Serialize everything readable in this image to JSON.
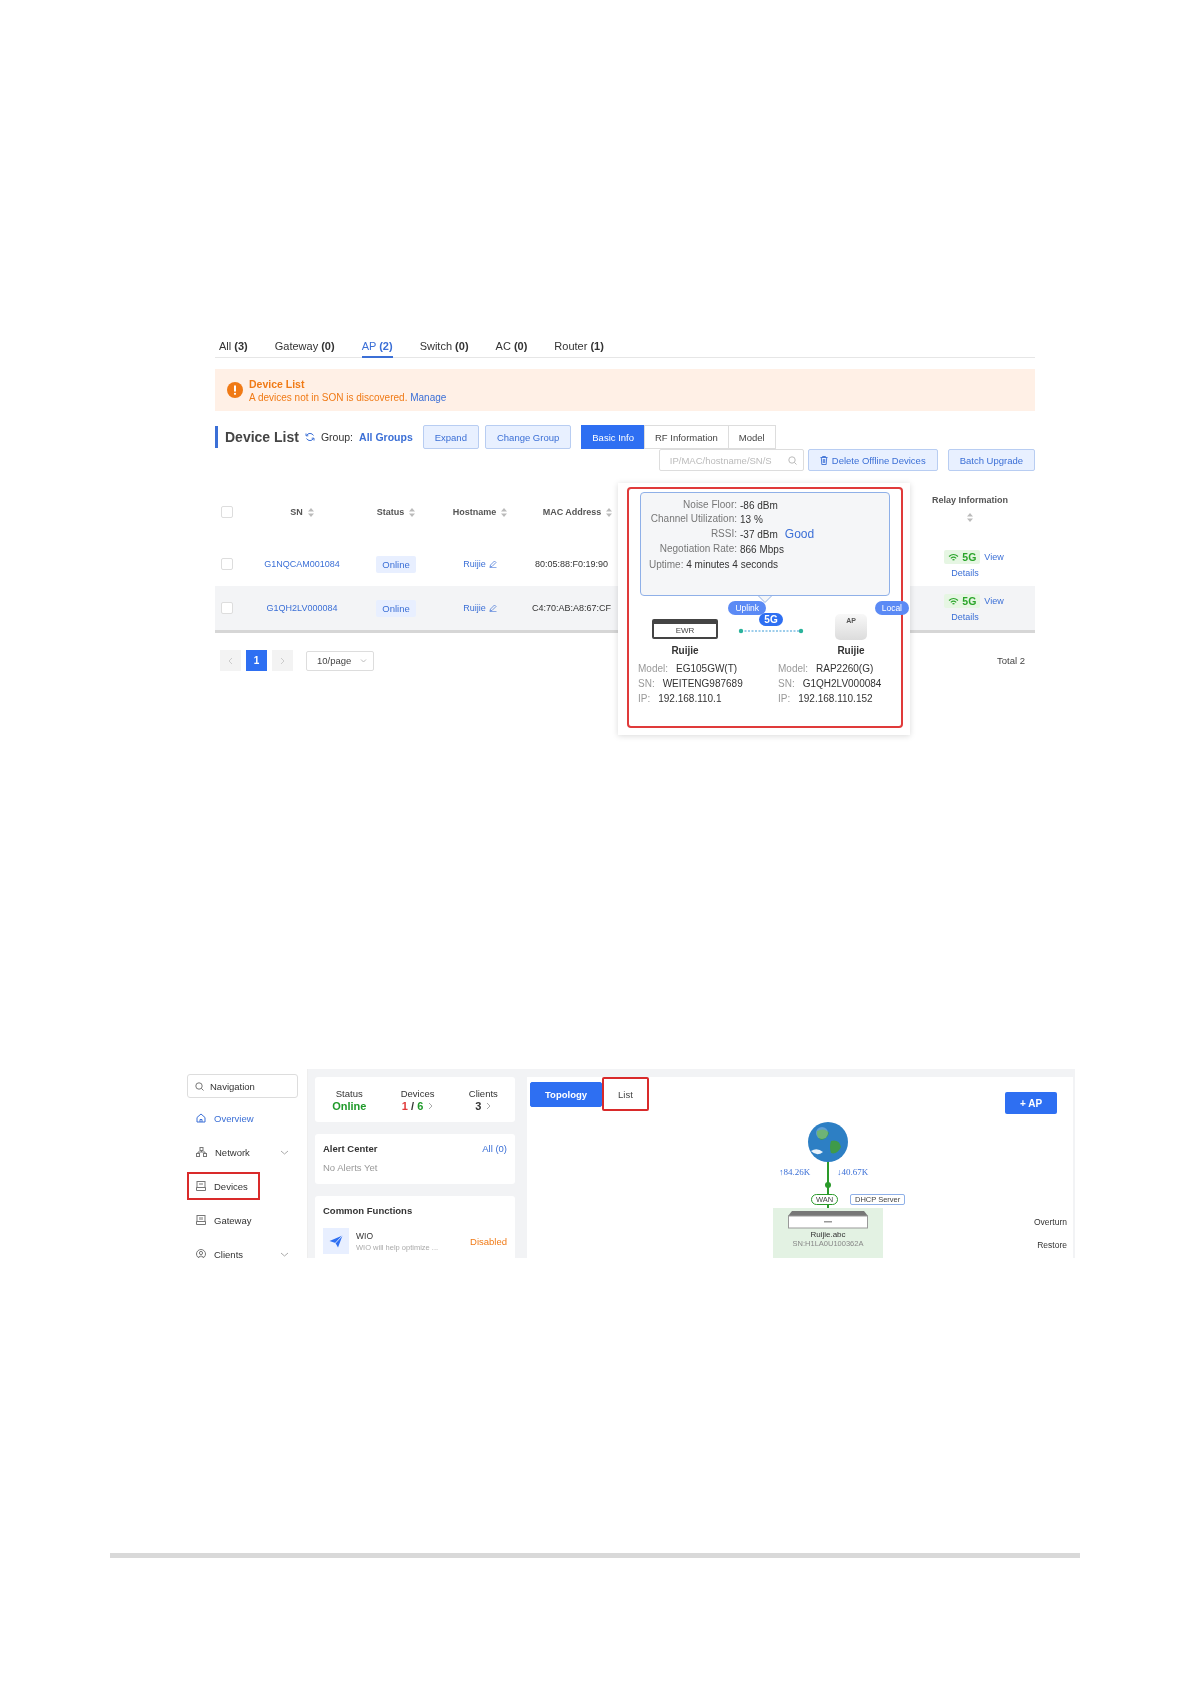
{
  "device_list_screen": {
    "tabs": [
      {
        "label": "All",
        "count": "(3)",
        "selected": false
      },
      {
        "label": "Gateway",
        "count": "(0)",
        "selected": false
      },
      {
        "label": "AP",
        "count": "(2)",
        "selected": true
      },
      {
        "label": "Switch",
        "count": "(0)",
        "selected": false
      },
      {
        "label": "AC",
        "count": "(0)",
        "selected": false
      },
      {
        "label": "Router",
        "count": "(1)",
        "selected": false
      }
    ],
    "alert": {
      "title": "Device List",
      "message": "A devices not in SON is discovered.",
      "link": "Manage"
    },
    "header": {
      "title": "Device List",
      "group_label": "Group:",
      "group_value": "All Groups",
      "buttons": [
        "Expand",
        "Change Group"
      ],
      "views": [
        {
          "label": "Basic Info",
          "selected": true
        },
        {
          "label": "RF Information",
          "selected": false
        },
        {
          "label": "Model",
          "selected": false
        }
      ],
      "search": {
        "placeholder": "IP/MAC/hostname/SN/S"
      },
      "actions": [
        {
          "label": "Delete Offline Devices",
          "kind": "delete"
        },
        {
          "label": "Batch Upgrade",
          "kind": "plain"
        }
      ]
    },
    "table": {
      "all_checked": false,
      "columns": [
        "SN",
        "Status",
        "Hostname",
        "MAC Address",
        "Relay Information"
      ],
      "rows": [
        {
          "checked": false,
          "highlighted": false,
          "sn": "G1NQCAM001084",
          "status": "Online",
          "hostname": "Ruijie",
          "mac": "80:05:88:F0:19:90",
          "band": "5G",
          "view": "View",
          "details": "Details"
        },
        {
          "checked": false,
          "highlighted": true,
          "sn": "G1QH2LV000084",
          "status": "Online",
          "hostname": "Ruijie",
          "mac": "C4:70:AB:A8:67:CF",
          "band": "5G",
          "view": "View",
          "details": "Details"
        }
      ]
    },
    "pagination": {
      "pages": [
        {
          "label": "1",
          "selected": true
        }
      ],
      "page_size": "10/page",
      "total": "Total 2"
    },
    "popover": {
      "highlighted": true,
      "stats": [
        {
          "label": "Noise Floor:",
          "value": "-86 dBm"
        },
        {
          "label": "Channel Utilization:",
          "value": "13 %"
        },
        {
          "label": "RSSI:",
          "value": "-37 dBm",
          "rating": "Good"
        },
        {
          "label": "Negotiation Rate:",
          "value": "866 Mbps"
        }
      ],
      "uptime": {
        "label": "Uptime:",
        "value": "4 minutes 4 seconds"
      },
      "band": "5G",
      "devices": [
        {
          "kind": "router",
          "badge": "Uplink",
          "device_label": "EWR",
          "name": "Ruijie",
          "model_label": "Model:",
          "model": "EG105GW(T)",
          "sn_label": "SN:",
          "sn": "WEITENG987689",
          "ip_label": "IP:",
          "ip": "192.168.110.1"
        },
        {
          "kind": "ap",
          "badge": "Local",
          "device_label": "AP",
          "name": "Ruijie",
          "model_label": "Model:",
          "model": "RAP2260(G)",
          "sn_label": "SN:",
          "sn": "G1QH2LV000084",
          "ip_label": "IP:",
          "ip": "192.168.110.152"
        }
      ]
    }
  },
  "overview_screen": {
    "navigation": {
      "search_label": "Navigation",
      "items": [
        {
          "label": "Overview",
          "kind": "home",
          "selected": true,
          "expandable": false,
          "highlighted": false
        },
        {
          "label": "Network",
          "kind": "network",
          "selected": false,
          "expandable": true,
          "highlighted": false
        },
        {
          "label": "Devices",
          "kind": "devices",
          "selected": false,
          "expandable": false,
          "highlighted": true
        },
        {
          "label": "Gateway",
          "kind": "gateway",
          "selected": false,
          "expandable": false,
          "highlighted": false
        },
        {
          "label": "Clients",
          "kind": "clients",
          "selected": false,
          "expandable": true,
          "highlighted": false
        }
      ]
    },
    "summary": [
      {
        "kind": "status",
        "label": "Status",
        "value": "Online"
      },
      {
        "kind": "ratio",
        "label": "Devices",
        "first": "1",
        "separator": "/",
        "second": "6"
      },
      {
        "kind": "count",
        "label": "Clients",
        "value": "3"
      }
    ],
    "alert_center": {
      "title": "Alert Center",
      "link": "All (0)",
      "empty": "No Alerts Yet"
    },
    "common_functions": {
      "title": "Common Functions",
      "items": [
        {
          "name": "WIO",
          "description": "WIO will help optimize ...",
          "status": "Disabled"
        }
      ]
    },
    "view_tabs": [
      {
        "label": "Topology",
        "selected": true,
        "highlighted": false
      },
      {
        "label": "List",
        "selected": false,
        "highlighted": true
      }
    ],
    "add_button": "+ AP",
    "topology": {
      "up_rate": "↑84.26K",
      "down_rate": "↓40.67K",
      "port": "WAN",
      "role": "DHCP Server",
      "device_name": "Ruijie.abc",
      "device_sn": "SN:H1LA0U100362A",
      "actions": [
        "Overturn",
        "Restore"
      ]
    }
  }
}
